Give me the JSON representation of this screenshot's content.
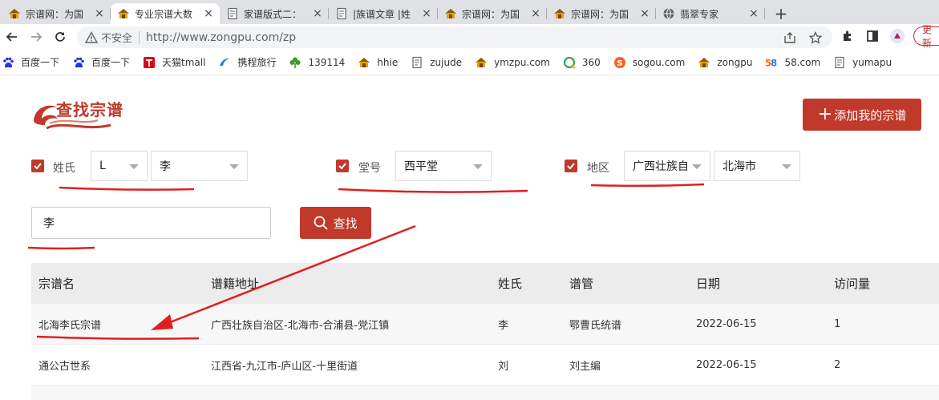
{
  "browser": {
    "tabs": [
      {
        "title": "宗谱网：为国",
        "active": false,
        "icon": "zongpu-favicon"
      },
      {
        "title": "专业宗谱大数",
        "active": true,
        "icon": "zongpu-favicon"
      },
      {
        "title": "家谱版式二：",
        "active": false,
        "icon": "doc-favicon"
      },
      {
        "title": "|族谱文章 |姓",
        "active": false,
        "icon": "doc-favicon"
      },
      {
        "title": "宗谱网：为国",
        "active": false,
        "icon": "zongpu-favicon"
      },
      {
        "title": "宗谱网：为国",
        "active": false,
        "icon": "zongpu-favicon"
      },
      {
        "title": "翡翠专家",
        "active": false,
        "icon": "globe-favicon"
      }
    ],
    "newtab": "+",
    "close": "×",
    "security_label": "不安全",
    "url": "http://www.zongpu.com/zp",
    "update_label": "更新",
    "bookmarks": [
      {
        "label": "百度一下",
        "icon": "baidu-paw-icon"
      },
      {
        "label": "百度一下",
        "icon": "baidu-paw-icon"
      },
      {
        "label": "天猫tmall",
        "icon": "tmall-icon"
      },
      {
        "label": "携程旅行",
        "icon": "ctrip-icon"
      },
      {
        "label": "139114",
        "icon": "clover-icon"
      },
      {
        "label": "hhie",
        "icon": "zongpu-favicon"
      },
      {
        "label": "zujude",
        "icon": "doc-favicon"
      },
      {
        "label": "ymzpu.com",
        "icon": "zongpu-favicon"
      },
      {
        "label": "360",
        "icon": "360-icon"
      },
      {
        "label": "sogou.com",
        "icon": "sogou-icon"
      },
      {
        "label": "zongpu",
        "icon": "zongpu-favicon"
      },
      {
        "label": "58.com",
        "icon": "58-icon"
      },
      {
        "label": "yumapu",
        "icon": "doc-favicon"
      }
    ]
  },
  "page": {
    "logo_text": "查找宗谱",
    "add_button": "添加我的宗谱",
    "add_plus": "+",
    "filters": {
      "surname_label": "姓氏",
      "surname_initial": "L",
      "surname_value": "李",
      "hall_label": "堂号",
      "hall_value": "西平堂",
      "region_label": "地区",
      "province_value": "广西壮族自治区",
      "city_value": "北海市"
    },
    "search": {
      "value": "李",
      "button": "查找"
    },
    "table": {
      "headers": [
        "宗谱名",
        "谱籍地址",
        "姓氏",
        "谱管",
        "日期",
        "访问量"
      ],
      "rows": [
        [
          "北海李氏宗谱",
          "广西壮族自治区-北海市-合浦县-党江镇",
          "李",
          "鄂曹氏统谱",
          "2022-06-15",
          "1"
        ],
        [
          "通公古世系",
          "江西省-九江市-庐山区-十里街道",
          "刘",
          "刘主编",
          "2022-06-15",
          "2"
        ]
      ]
    },
    "accent_color": "#c0392b"
  }
}
